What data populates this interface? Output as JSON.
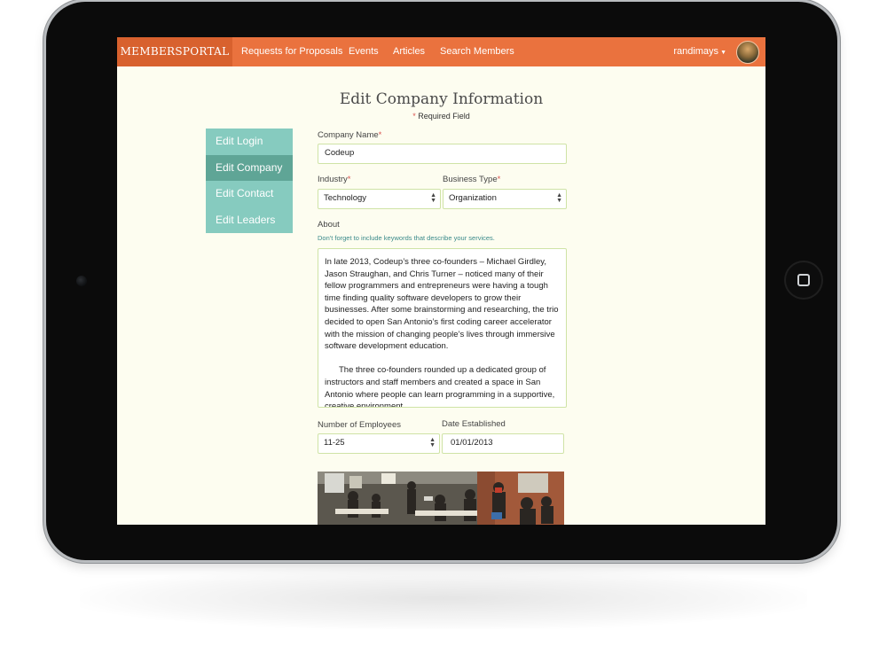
{
  "navbar": {
    "brand": "MEMBERSPORTAL",
    "links": [
      "Requests for Proposals",
      "Events",
      "Articles",
      "Search Members"
    ],
    "username": "randimays",
    "accent_color": "#ea723e"
  },
  "page": {
    "title": "Edit Company Information",
    "required_asterisk": "*",
    "required_text": "Required Field"
  },
  "sidebar": {
    "items": [
      {
        "label": "Edit Login"
      },
      {
        "label": "Edit Company"
      },
      {
        "label": "Edit Contact"
      },
      {
        "label": "Edit Leaders"
      }
    ],
    "active": "Edit Company"
  },
  "form": {
    "company_name": {
      "label": "Company Name",
      "value": "Codeup"
    },
    "industry": {
      "label": "Industry",
      "value": "Technology"
    },
    "business_type": {
      "label": "Business Type",
      "value": "Organization"
    },
    "about": {
      "label": "About",
      "hint": "Don't forget to include keywords that describe your services.",
      "paragraphs": [
        "In late 2013, Codeup’s three co-founders – Michael Girdley, Jason Straughan, and Chris Turner – noticed many of their fellow programmers and entrepreneurs were having a tough time finding quality software developers to grow their businesses. After some brainstorming and researching, the trio decided to open San Antonio’s first coding career accelerator with the mission of changing people’s lives through immersive software development education.",
        "The three co-founders rounded up a dedicated group of instructors and staff members and created a space in San Antonio where people can learn programming in a supportive, creative environment."
      ]
    },
    "employees": {
      "label": "Number of Employees",
      "value": "11-25"
    },
    "date_established": {
      "label": "Date Established",
      "value": "01/01/2013"
    }
  }
}
